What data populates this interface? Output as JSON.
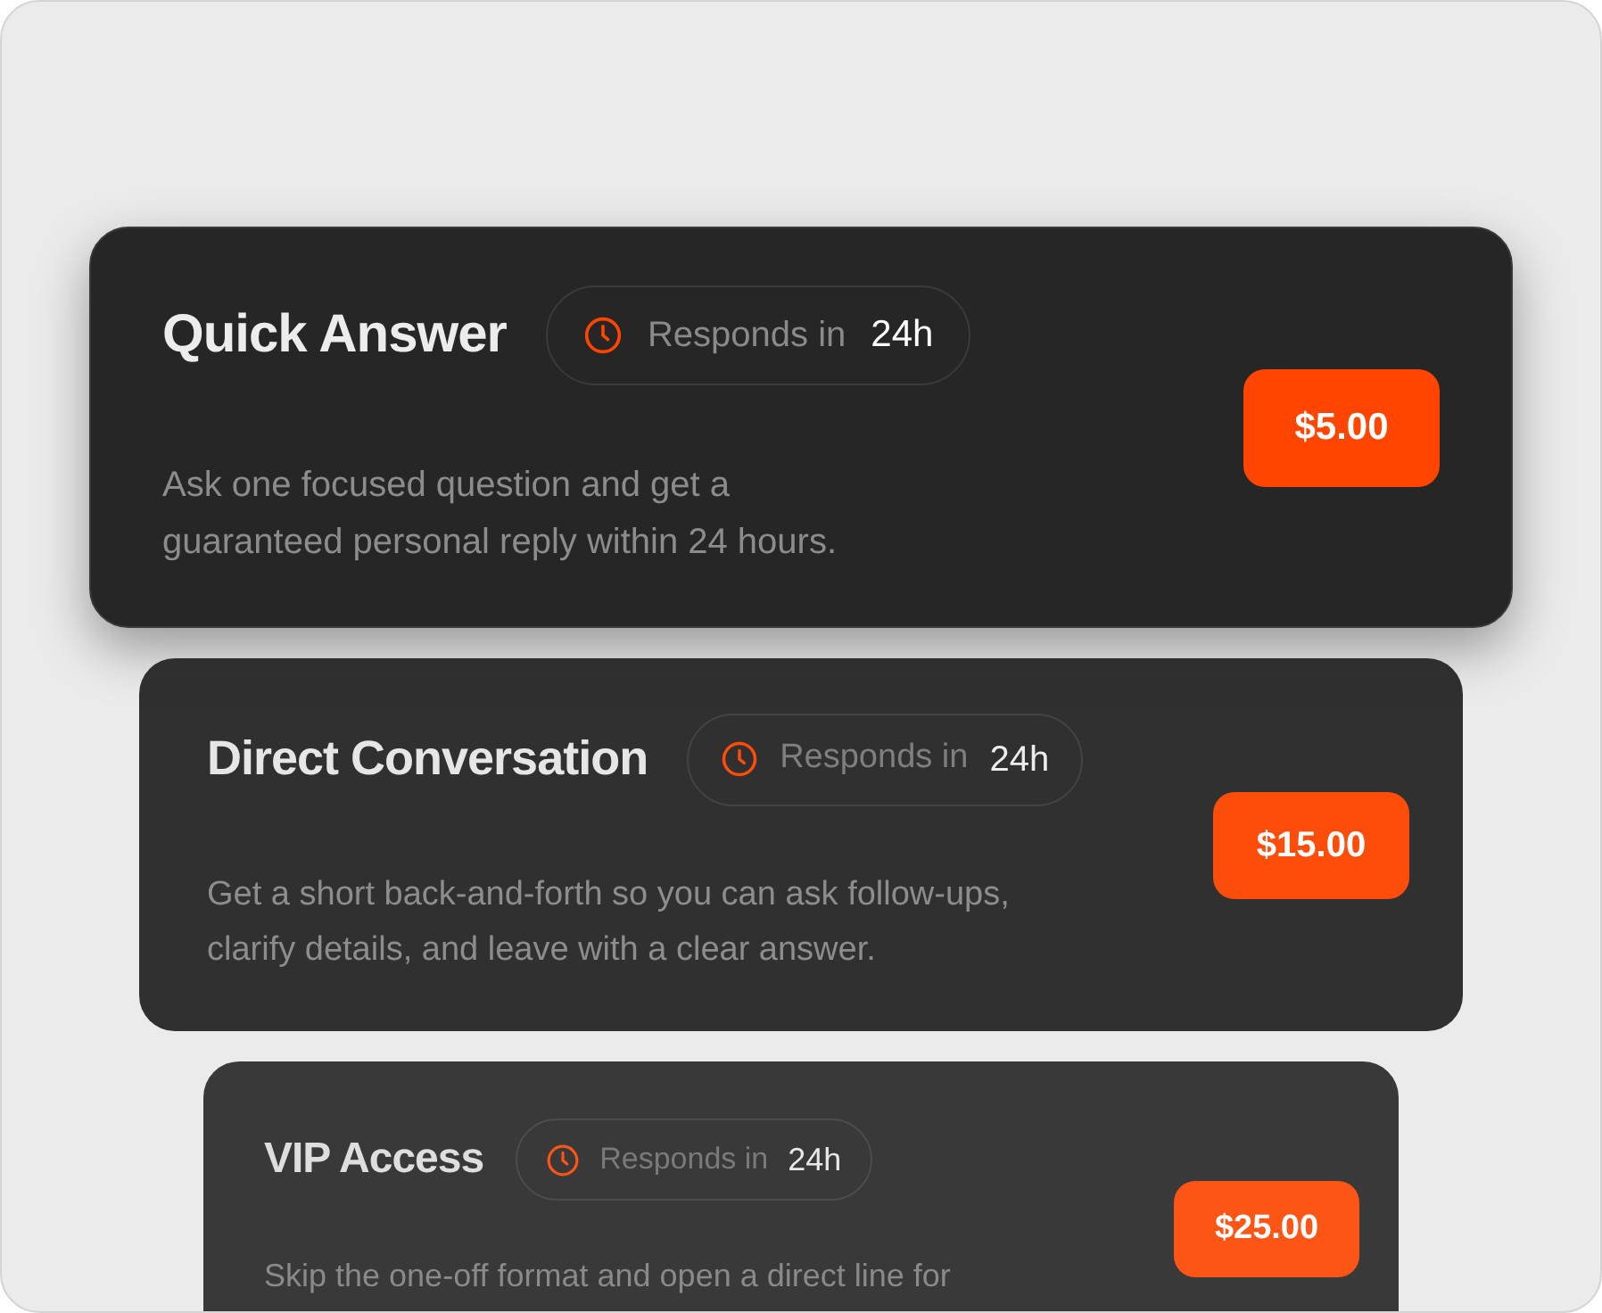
{
  "plans": [
    {
      "title": "Quick Answer",
      "response_label": "Responds in",
      "response_time": "24h",
      "description": "Ask one focused question and get a guaranteed personal reply within 24 hours.",
      "price": "$5.00"
    },
    {
      "title": "Direct Conversation",
      "response_label": "Responds in",
      "response_time": "24h",
      "description": "Get a short back-and-forth so you can ask follow-ups, clarify details, and leave with a clear answer.",
      "price": "$15.00"
    },
    {
      "title": "VIP Access",
      "response_label": "Responds in",
      "response_time": "24h",
      "description": "Skip the one-off format and open a direct line for",
      "price": "$25.00"
    }
  ]
}
